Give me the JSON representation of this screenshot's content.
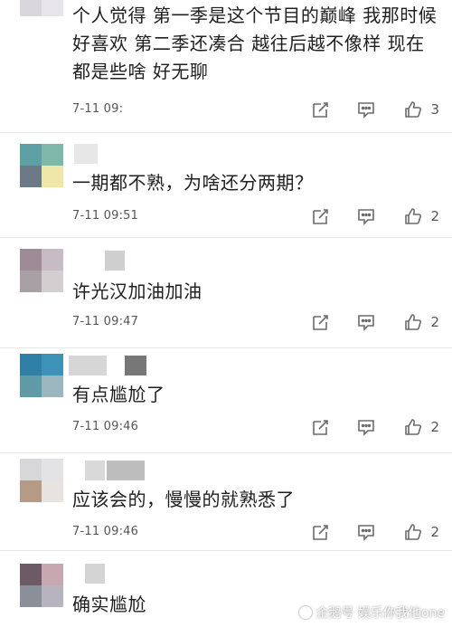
{
  "comments": [
    {
      "text": "个人觉得 第一季是这个节目的巅峰 我那时候好喜欢 第二季还凑合 越往后越不像样 现在都是些啥 好无聊",
      "time": "7-11 09:",
      "likes": "3",
      "avatar": [
        "#b9b3c2",
        "#c9c4cf",
        "#d9d6dd",
        "#e7e5ea"
      ]
    },
    {
      "text": "一期都不熟，为啥还分两期？",
      "time": "7-11 09:51",
      "likes": "2",
      "avatar": [
        "#5e9fa3",
        "#7fb7a9",
        "#6b7a86",
        "#efe7a8"
      ]
    },
    {
      "text": "许光汉加油加油",
      "time": "7-11 09:47",
      "likes": "2",
      "avatar": [
        "#9d8b96",
        "#c7bcc3",
        "#a8a0a4",
        "#d3cfd1"
      ]
    },
    {
      "text": "有点尴尬了",
      "time": "7-11 09:46",
      "likes": "2",
      "avatar": [
        "#2f7fa7",
        "#3d93b7",
        "#5f9aa6",
        "#9cb6bf"
      ]
    },
    {
      "text": "应该会的，慢慢的就熟悉了",
      "time": "7-11 09:46",
      "likes": "2",
      "avatar": [
        "#d7d7d9",
        "#e3e3e5",
        "#b59a86",
        "#e6e3e1"
      ]
    },
    {
      "text": "确实尴尬",
      "time": "",
      "likes": "",
      "avatar": [
        "#6e5a64",
        "#c7a8b0",
        "#8a8f99",
        "#b7b3c0"
      ]
    }
  ],
  "watermark": "企鹅号 娱乐你我他one",
  "icons": {
    "edit": "edit-icon",
    "reply": "comment-icon",
    "like": "thumbs-up-icon"
  },
  "colors": {
    "icon": "#6b6b6b",
    "text": "#202020",
    "time": "#555555",
    "divider": "#e6e6e6"
  }
}
